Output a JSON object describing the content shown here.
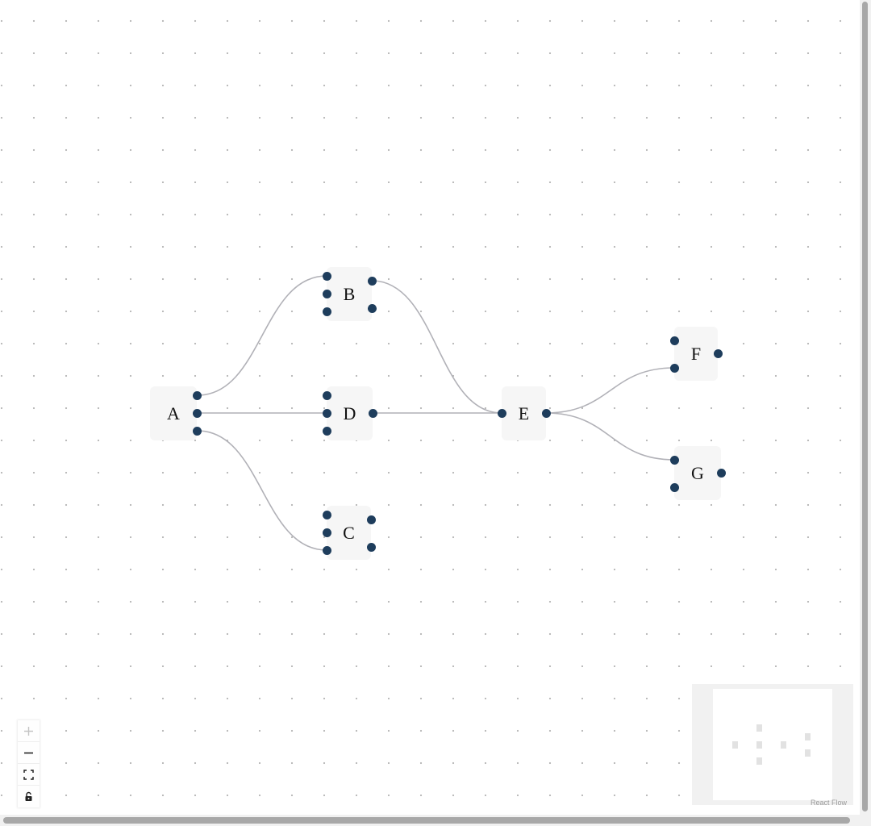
{
  "nodes": [
    {
      "id": "A",
      "label": "A"
    },
    {
      "id": "B",
      "label": "B"
    },
    {
      "id": "C",
      "label": "C"
    },
    {
      "id": "D",
      "label": "D"
    },
    {
      "id": "E",
      "label": "E"
    },
    {
      "id": "F",
      "label": "F"
    },
    {
      "id": "G",
      "label": "G"
    }
  ],
  "edges": [
    {
      "source": "A",
      "target": "B"
    },
    {
      "source": "A",
      "target": "D"
    },
    {
      "source": "A",
      "target": "C"
    },
    {
      "source": "B",
      "target": "E"
    },
    {
      "source": "D",
      "target": "E"
    },
    {
      "source": "E",
      "target": "F"
    },
    {
      "source": "E",
      "target": "G"
    }
  ],
  "controls": [
    {
      "name": "zoom-in-icon",
      "state": "disabled"
    },
    {
      "name": "zoom-out-icon",
      "state": "enabled"
    },
    {
      "name": "fit-view-icon",
      "state": "enabled"
    },
    {
      "name": "lock-icon",
      "state": "unlocked"
    }
  ],
  "attribution": "React Flow",
  "colors": {
    "handle": "#1e3d5c",
    "node_bg": "#f6f6f6",
    "edge": "#b1b1b7",
    "dots": "#b8b8b8",
    "minimap_bg": "#f1f1f1",
    "minimap_node": "#e2e2e2"
  }
}
